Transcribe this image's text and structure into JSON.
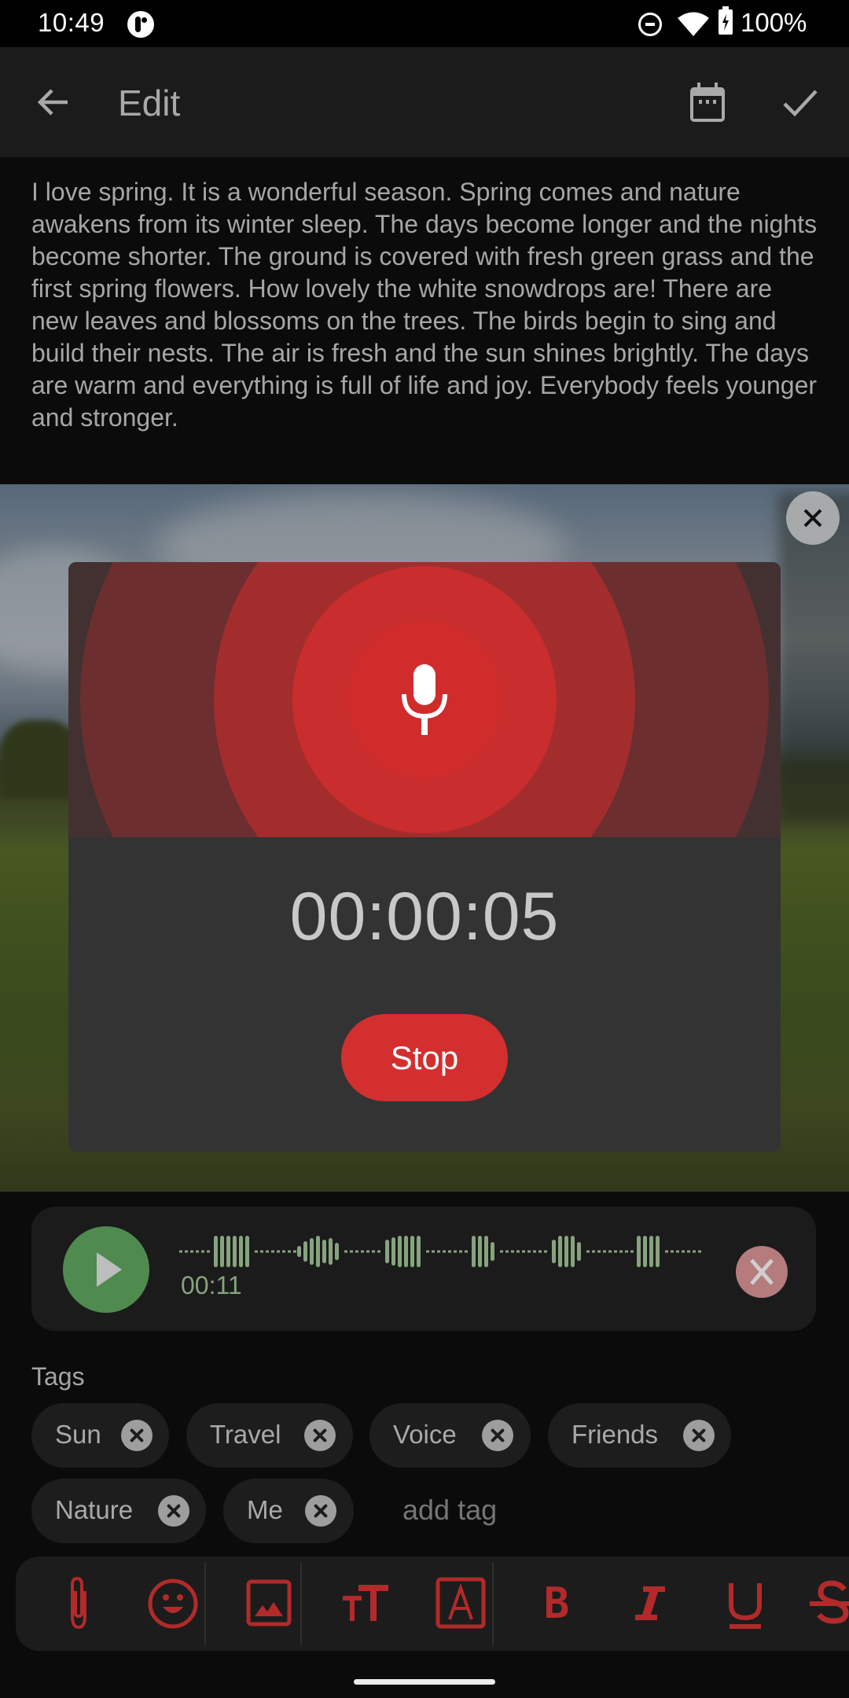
{
  "status_bar": {
    "time": "10:49",
    "battery": "100%",
    "icons": [
      "app-notification-icon",
      "do-not-disturb-icon",
      "wifi-icon",
      "battery-charging-icon"
    ]
  },
  "app_bar": {
    "title": "Edit",
    "back_icon": "arrow-left-icon",
    "calendar_icon": "calendar-icon",
    "confirm_icon": "check-icon"
  },
  "note": {
    "body": "I love spring. It is a wonderful season. Spring comes and nature awakens from its winter sleep. The days become longer and the nights become shorter. The ground is covered with fresh green grass and the first spring flowers. How lovely the white snowdrops are! There are new leaves and blossoms on the trees. The birds begin to sing and build their nests. The air is fresh and the sun shines brightly. The days are warm and everything is full of life and joy. Everybody feels younger and stronger."
  },
  "recording_dialog": {
    "timer": "00:00:05",
    "stop_label": "Stop",
    "icon": "microphone-icon",
    "accent_color": "#d32f2f"
  },
  "audio_attachment": {
    "duration": "00:11",
    "play_icon": "play-icon",
    "delete_icon": "close-icon",
    "wave_color": "#86a37e"
  },
  "tags": {
    "label": "Tags",
    "items": [
      {
        "label": "Sun"
      },
      {
        "label": "Travel"
      },
      {
        "label": "Voice"
      },
      {
        "label": "Friends"
      },
      {
        "label": "Nature"
      },
      {
        "label": "Me"
      }
    ],
    "add_placeholder": "add tag"
  },
  "format_toolbar": {
    "accent_color": "#b22a2a",
    "buttons": [
      {
        "name": "attach",
        "icon": "paperclip-icon"
      },
      {
        "name": "emoji",
        "icon": "smiley-icon"
      },
      {
        "name": "image",
        "icon": "image-icon"
      },
      {
        "name": "text-size",
        "icon": "text-size-icon",
        "glyph": "TT"
      },
      {
        "name": "text-color",
        "icon": "text-color-icon",
        "glyph": "A"
      },
      {
        "name": "bold",
        "icon": "bold-icon",
        "glyph": "B"
      },
      {
        "name": "italic",
        "icon": "italic-icon",
        "glyph": "I"
      },
      {
        "name": "underline",
        "icon": "underline-icon",
        "glyph": "U"
      },
      {
        "name": "strikethrough",
        "icon": "strikethrough-icon",
        "glyph": "S"
      }
    ]
  }
}
